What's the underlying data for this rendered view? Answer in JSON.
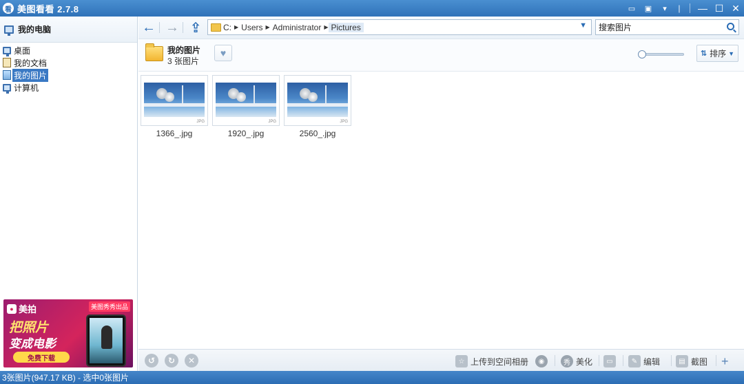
{
  "app": {
    "title": "美图看看 2.7.8",
    "icon_glyph": "看"
  },
  "titlebar": {
    "icons": [
      "chat-icon",
      "skin-icon",
      "menu-icon",
      "minimize-icon",
      "maximize-icon",
      "close-icon"
    ],
    "accent": "#2f72b9"
  },
  "sidebar": {
    "header": "我的电脑",
    "items": [
      {
        "label": "桌面",
        "icon": "desktop-icon"
      },
      {
        "label": "我的文档",
        "icon": "documents-icon"
      },
      {
        "label": "我的图片",
        "icon": "pictures-icon",
        "selected": true
      },
      {
        "label": "计算机",
        "icon": "computer-icon"
      }
    ],
    "ad": {
      "brand": "美拍",
      "tag": "美图秀秀出品",
      "line1": "把照片",
      "line2": "变成电影",
      "button": "免费下载"
    }
  },
  "nav": {
    "path": [
      "C:",
      "Users",
      "Administrator",
      "Pictures"
    ],
    "search_placeholder": "搜索图片"
  },
  "folder": {
    "title": "我的图片",
    "count": "3 张图片",
    "sort_label": "排序"
  },
  "thumbnails": [
    {
      "name": "1366_.jpg",
      "ext": "JPG"
    },
    {
      "name": "1920_.jpg",
      "ext": "JPG"
    },
    {
      "name": "2560_.jpg",
      "ext": "JPG"
    }
  ],
  "toolbar": {
    "upload": "上传到空间相册",
    "beautify": "美化",
    "edit": "编辑",
    "cut": "截图"
  },
  "status": {
    "text": "3张图片(947.17 KB) - 选中0张图片"
  }
}
